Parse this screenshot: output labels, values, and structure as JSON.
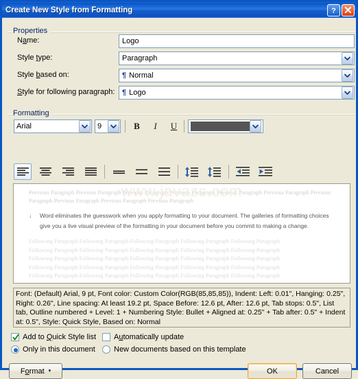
{
  "window": {
    "title": "Create New Style from Formatting",
    "help_button": "?",
    "close_button": "x"
  },
  "properties": {
    "group_label": "Properties",
    "fields": [
      {
        "label_pre": "N",
        "label_key": "a",
        "label_post": "me:",
        "value": "Logo",
        "type": "text"
      },
      {
        "label_pre": "Style ",
        "label_key": "t",
        "label_post": "ype:",
        "value": "Paragraph",
        "type": "dropdown"
      },
      {
        "label_pre": "Style ",
        "label_key": "b",
        "label_post": "ased on:",
        "value": "Normal",
        "type": "dropdown",
        "pilcrow": "¶"
      },
      {
        "label_pre": "",
        "label_key": "S",
        "label_post": "tyle for following paragraph:",
        "value": "Logo",
        "type": "dropdown",
        "pilcrow": "¶"
      }
    ]
  },
  "formatting": {
    "group_label": "Formatting",
    "font_family": "Arial",
    "font_size": "9",
    "bold_label": "B",
    "italic_label": "I",
    "underline_label": "U",
    "font_color": "#555555",
    "align_buttons": [
      "align-left",
      "align-center",
      "align-right",
      "align-justify"
    ],
    "spacing_buttons": [
      "line-spacing-single",
      "line-spacing-1-5",
      "line-spacing-double"
    ],
    "para_spacing_buttons": [
      "decrease-paragraph-spacing",
      "increase-paragraph-spacing"
    ],
    "indent_buttons": [
      "decrease-indent",
      "increase-indent"
    ]
  },
  "preview": {
    "watermark": "www.javazs.com",
    "previous_paragraph": "Previous Paragraph Previous Paragraph Previous Paragraph Previous Paragraph Previous Paragraph Previous Paragraph Previous Paragraph Previous Paragraph Previous Paragraph Previous Paragraph",
    "bullet": "↓",
    "sample_text": "Word eliminates the guesswork when you apply formatting to your document. The galleries of formatting choices give you a live visual preview of the formatting in your document before you commit to making a change.",
    "following_line": "Following Paragraph Following Paragraph Following Paragraph Following Paragraph Following Paragraph",
    "following_count": 5
  },
  "description": "Font: (Default) Arial, 9 pt, Font color: Custom Color(RGB(85,85,85)), Indent: Left:  0.01\", Hanging:  0.25\", Right:  0.26\", Line spacing:  At least 19.2 pt, Space Before:  12.6 pt, After:  12.6 pt, Tab stops:  0.5\", List tab, Outline numbered + Level: 1 + Numbering Style: Bullet + Aligned at:  0.25\" + Tab after:  0.5\" + Indent at:  0.5\", Style: Quick Style, Based on: Normal",
  "options": {
    "add_to_quick_style": {
      "label_pre": "Add to ",
      "label_key": "Q",
      "label_post": "uick Style list",
      "checked": true
    },
    "automatically_update": {
      "label_pre": "A",
      "label_key": "u",
      "label_post": "tomatically update",
      "checked": false
    },
    "only_this_document": {
      "label": "Only in this document",
      "selected": true
    },
    "new_documents": {
      "label": "New documents based on this template",
      "selected": false
    }
  },
  "buttons": {
    "format_pre": "F",
    "format_key": "o",
    "format_post": "rmat",
    "format_caret": "▾",
    "ok": "OK",
    "cancel": "Cancel"
  }
}
